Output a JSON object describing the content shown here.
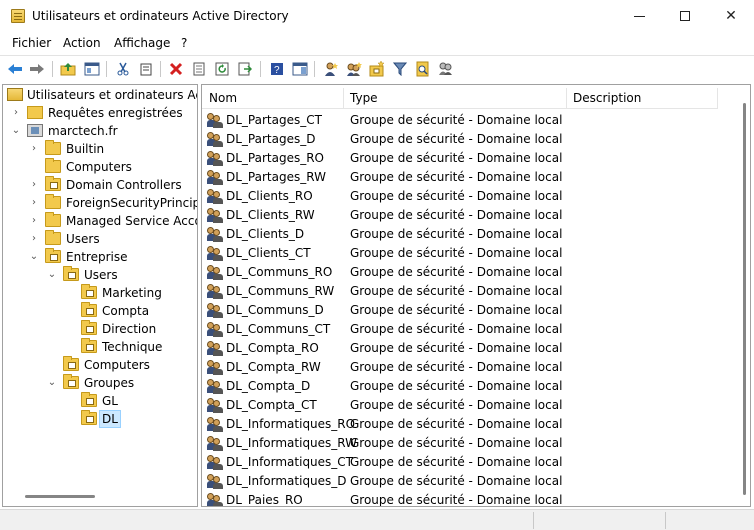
{
  "window": {
    "title": "Utilisateurs et ordinateurs Active Directory",
    "minimize_icon": "minimize-icon",
    "maximize_icon": "maximize-icon",
    "close_label": "✕"
  },
  "menu": {
    "items": [
      "Fichier",
      "Action",
      "Affichage",
      "?"
    ]
  },
  "toolbar": {
    "buttons": [
      "back-icon",
      "forward-icon",
      "up-icon",
      "show-hide-console-tree-icon",
      "cut-icon",
      "copy-icon",
      "delete-icon",
      "properties-icon",
      "refresh-icon",
      "export-list-icon",
      "help-icon",
      "action-pane-icon",
      "new-user-icon",
      "new-group-icon",
      "new-ou-icon",
      "filter-icon",
      "find-icon",
      "add-to-group-icon"
    ]
  },
  "tree": {
    "root": "Utilisateurs et ordinateurs Active Directory",
    "saved_queries": "Requêtes enregistrées",
    "domain": "marctech.fr",
    "items": [
      {
        "label": "Builtin",
        "level": 1,
        "toggle": "›"
      },
      {
        "label": "Computers",
        "level": 1,
        "toggle": ""
      },
      {
        "label": "Domain Controllers",
        "level": 1,
        "toggle": "›"
      },
      {
        "label": "ForeignSecurityPrincipals",
        "level": 1,
        "toggle": "›"
      },
      {
        "label": "Managed Service Accounts",
        "level": 1,
        "toggle": "›"
      },
      {
        "label": "Users",
        "level": 1,
        "toggle": "›"
      },
      {
        "label": "Entreprise",
        "level": 1,
        "toggle": "⌄"
      },
      {
        "label": "Users",
        "level": 2,
        "toggle": "⌄"
      },
      {
        "label": "Marketing",
        "level": 3,
        "toggle": ""
      },
      {
        "label": "Compta",
        "level": 3,
        "toggle": ""
      },
      {
        "label": "Direction",
        "level": 3,
        "toggle": ""
      },
      {
        "label": "Technique",
        "level": 3,
        "toggle": ""
      },
      {
        "label": "Computers",
        "level": 2,
        "toggle": ""
      },
      {
        "label": "Groupes",
        "level": 2,
        "toggle": "⌄"
      },
      {
        "label": "GL",
        "level": 3,
        "toggle": ""
      },
      {
        "label": "DL",
        "level": 3,
        "toggle": "",
        "selected": true
      }
    ]
  },
  "list": {
    "columns": [
      "Nom",
      "Type",
      "Description"
    ],
    "rows": [
      {
        "name": "DL_Partages_CT",
        "type": "Groupe de sécurité - Domaine local"
      },
      {
        "name": "DL_Partages_D",
        "type": "Groupe de sécurité - Domaine local"
      },
      {
        "name": "DL_Partages_RO",
        "type": "Groupe de sécurité - Domaine local"
      },
      {
        "name": "DL_Partages_RW",
        "type": "Groupe de sécurité - Domaine local"
      },
      {
        "name": "DL_Clients_RO",
        "type": "Groupe de sécurité - Domaine local"
      },
      {
        "name": "DL_Clients_RW",
        "type": "Groupe de sécurité - Domaine local"
      },
      {
        "name": "DL_Clients_D",
        "type": "Groupe de sécurité - Domaine local"
      },
      {
        "name": "DL_Clients_CT",
        "type": "Groupe de sécurité - Domaine local"
      },
      {
        "name": "DL_Communs_RO",
        "type": "Groupe de sécurité - Domaine local"
      },
      {
        "name": "DL_Communs_RW",
        "type": "Groupe de sécurité - Domaine local"
      },
      {
        "name": "DL_Communs_D",
        "type": "Groupe de sécurité - Domaine local"
      },
      {
        "name": "DL_Communs_CT",
        "type": "Groupe de sécurité - Domaine local"
      },
      {
        "name": "DL_Compta_RO",
        "type": "Groupe de sécurité - Domaine local"
      },
      {
        "name": "DL_Compta_RW",
        "type": "Groupe de sécurité - Domaine local"
      },
      {
        "name": "DL_Compta_D",
        "type": "Groupe de sécurité - Domaine local"
      },
      {
        "name": "DL_Compta_CT",
        "type": "Groupe de sécurité - Domaine local"
      },
      {
        "name": "DL_Informatiques_RO",
        "type": "Groupe de sécurité - Domaine local"
      },
      {
        "name": "DL_Informatiques_RW",
        "type": "Groupe de sécurité - Domaine local"
      },
      {
        "name": "DL_Informatiques_CT",
        "type": "Groupe de sécurité - Domaine local"
      },
      {
        "name": "DL_Informatiques_D",
        "type": "Groupe de sécurité - Domaine local"
      },
      {
        "name": "DL_Paies_RO",
        "type": "Groupe de sécurité - Domaine local"
      }
    ]
  },
  "colors": {
    "selection": "#cce8ff",
    "folder": "#f2c94c",
    "border": "#a0a0a0"
  }
}
